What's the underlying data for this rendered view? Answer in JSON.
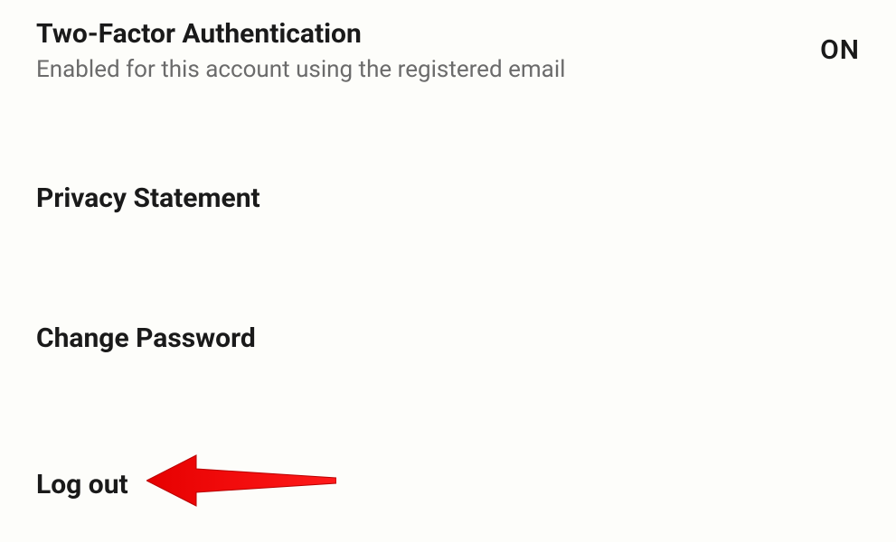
{
  "two_factor": {
    "title": "Two-Factor Authentication",
    "subtitle": "Enabled for this account using the registered email",
    "state": "ON"
  },
  "privacy_statement": {
    "label": "Privacy Statement"
  },
  "change_password": {
    "label": "Change Password"
  },
  "logout": {
    "label": "Log out"
  }
}
